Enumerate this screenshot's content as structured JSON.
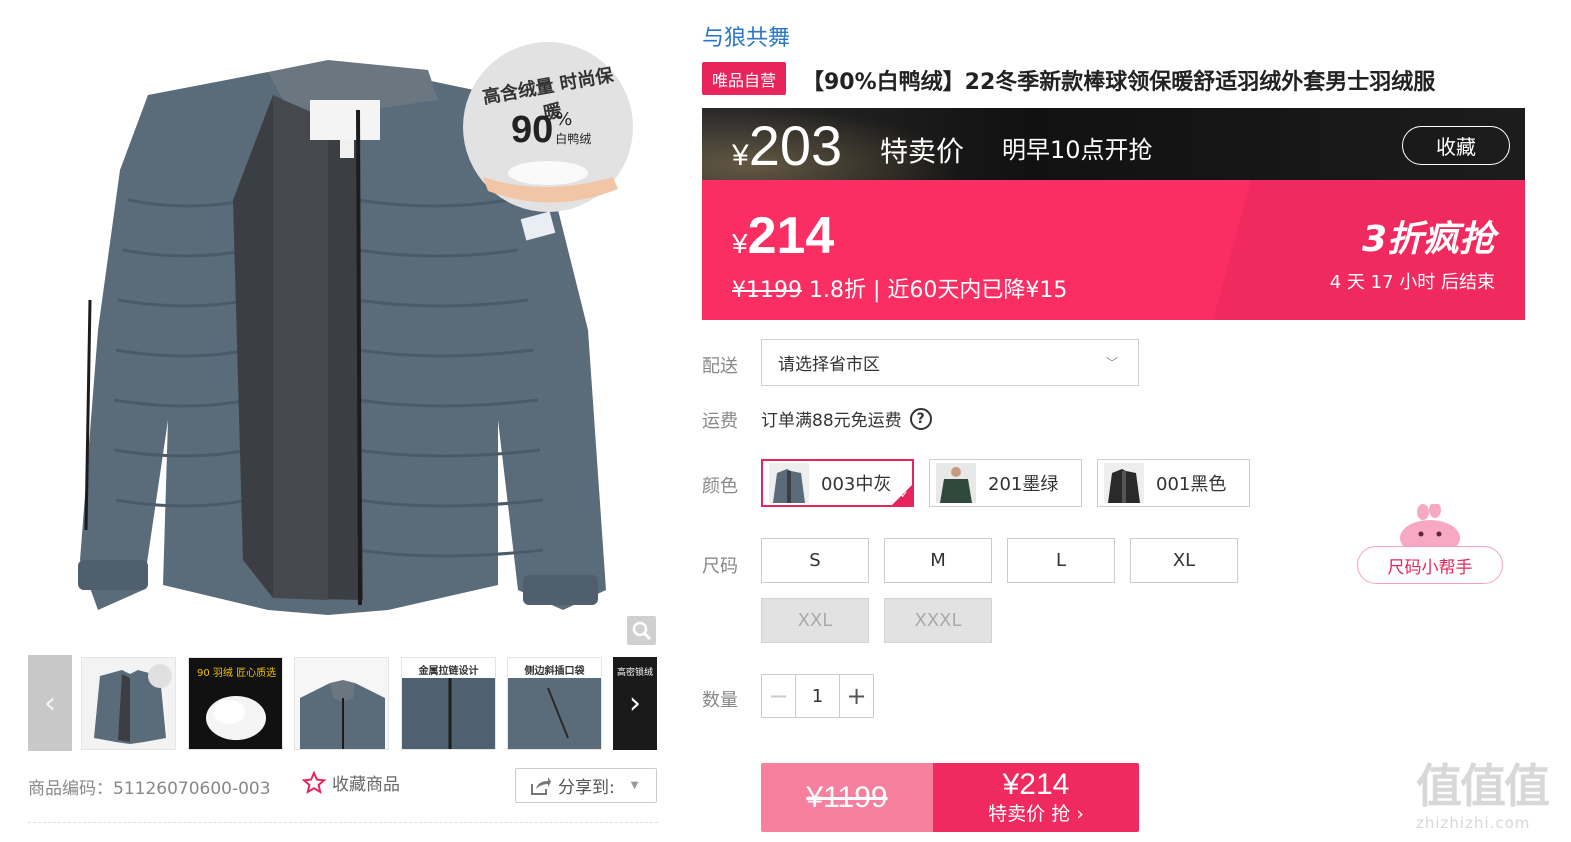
{
  "gallery": {
    "badge": {
      "line1": "高含绒量 时尚保暖",
      "percent_value": "90",
      "percent_sign": "%",
      "material": "白鸭绒"
    },
    "thumbnails": [
      {
        "caption": ""
      },
      {
        "caption": "90 羽绒 匠心质选"
      },
      {
        "caption": ""
      },
      {
        "caption": "金属拉链设计"
      },
      {
        "caption": "侧边斜插口袋"
      },
      {
        "caption": "高密锁绒"
      }
    ],
    "sku_code": "商品编码：51126070600-003",
    "favorite_label": "收藏商品",
    "share_label": "分享到:"
  },
  "product": {
    "brand": "与狼共舞",
    "vip_tag": "唯品自营",
    "title": "【90%白鸭绒】22冬季新款棒球领保暖舒适羽绒外套男士羽绒服"
  },
  "presale": {
    "currency": "¥",
    "price": "203",
    "label": "特卖价",
    "time": "明早10点开抢",
    "collect_label": "收藏"
  },
  "sale": {
    "currency": "¥",
    "price": "214",
    "original_price": "¥1199",
    "discount": "1.8折",
    "history_note": "| 近60天内已降¥15",
    "flash_label": "3折疯抢",
    "countdown": "4 天 17 小时 后结束"
  },
  "shipping": {
    "label": "配送",
    "placeholder": "请选择省市区"
  },
  "fee": {
    "label": "运费",
    "text": "订单满88元免运费",
    "help": "?"
  },
  "colors": {
    "label": "颜色",
    "options": [
      {
        "name": "003中灰",
        "selected": true
      },
      {
        "name": "201墨绿",
        "selected": false
      },
      {
        "name": "001黑色",
        "selected": false
      }
    ]
  },
  "sizes": {
    "label": "尺码",
    "options": [
      {
        "name": "S",
        "available": true
      },
      {
        "name": "M",
        "available": true
      },
      {
        "name": "L",
        "available": true
      },
      {
        "name": "XL",
        "available": true
      },
      {
        "name": "XXL",
        "available": false
      },
      {
        "name": "XXXL",
        "available": false
      }
    ],
    "helper_label": "尺码小帮手"
  },
  "quantity": {
    "label": "数量",
    "minus": "−",
    "value": "1",
    "plus": "+"
  },
  "buy": {
    "original_price": "¥1199",
    "price": "¥214",
    "action": "特卖价 抢 ›"
  },
  "watermark": {
    "logo": "值值值",
    "url": "zhizhizhi.com"
  },
  "colors_theme": {
    "accent": "#fb2e64",
    "brand_blue": "#2a77c9",
    "dark_bar": "#111111"
  }
}
